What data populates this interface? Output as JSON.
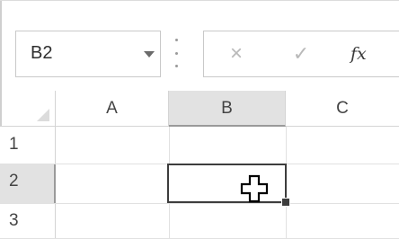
{
  "formula_bar": {
    "name_box_value": "B2",
    "cancel_icon": "×",
    "enter_icon": "✓",
    "fx_label": "fx"
  },
  "sheet": {
    "columns": [
      "A",
      "B",
      "C"
    ],
    "rows": [
      "1",
      "2",
      "3"
    ],
    "selected_column": "B",
    "selected_row": "2",
    "active_cell": "B2"
  },
  "cursor": {
    "icon": "cell-select-plus-cursor"
  }
}
